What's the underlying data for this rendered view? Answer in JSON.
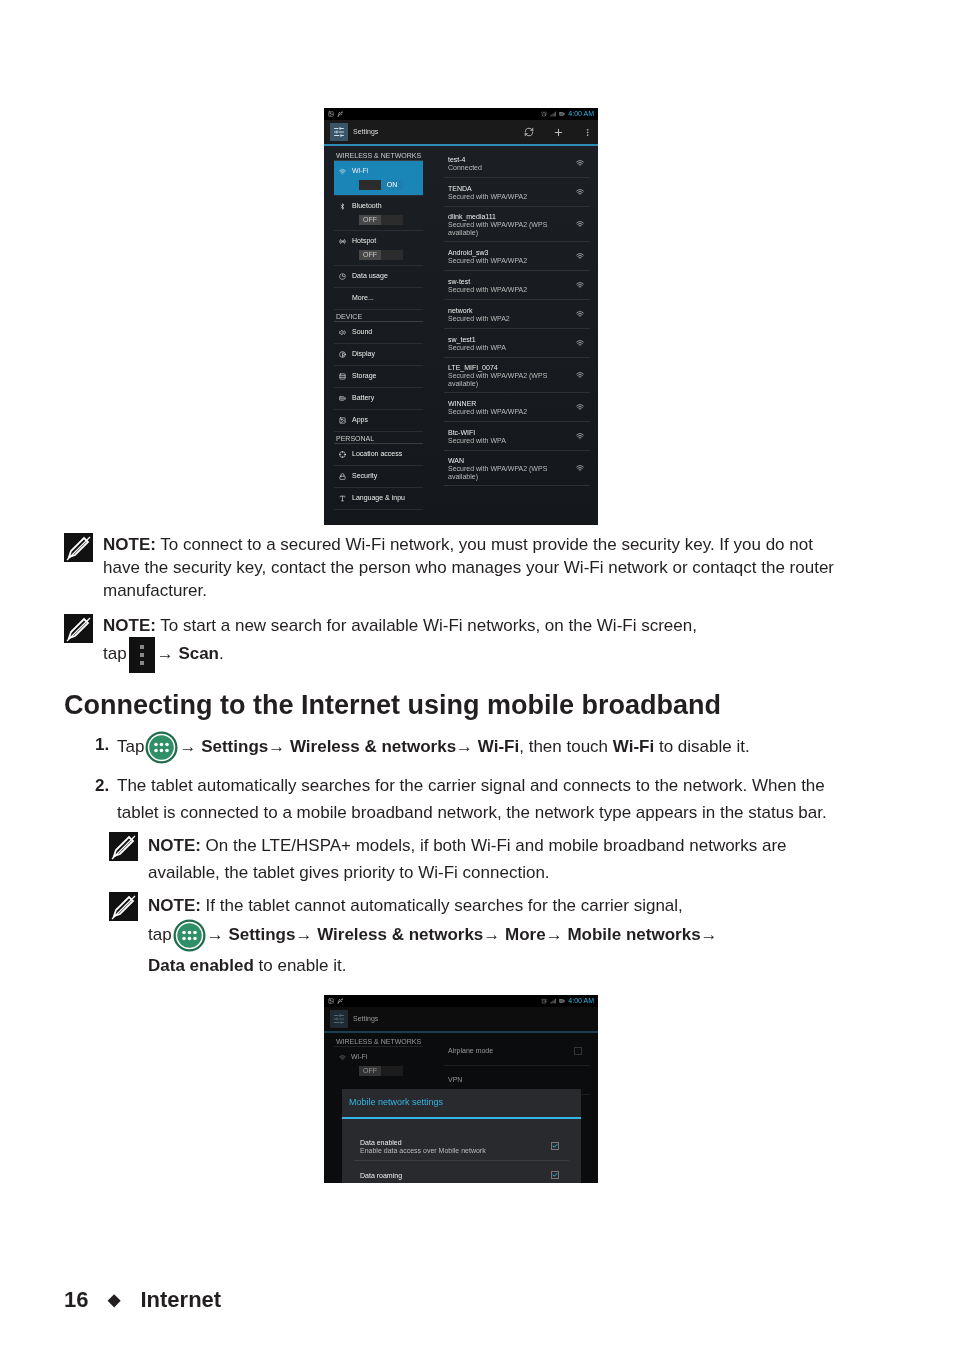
{
  "wifi_screenshot": {
    "status_time": "4:00 AM",
    "title": "Settings",
    "sidebar": [
      {
        "kind": "header",
        "label": "WIRELESS & NETWORKS"
      },
      {
        "kind": "item",
        "label": "Wi-Fi",
        "selected": true,
        "toggle": {
          "label": "ON",
          "on": true
        }
      },
      {
        "kind": "item",
        "label": "Bluetooth",
        "selected": false,
        "toggle": {
          "label": "OFF",
          "on": false
        }
      },
      {
        "kind": "item",
        "label": "Hotspot",
        "selected": false,
        "toggle": {
          "label": "OFF",
          "on": false
        }
      },
      {
        "kind": "item",
        "label": "Data usage",
        "selected": false
      },
      {
        "kind": "item",
        "label": "More...",
        "selected": false
      },
      {
        "kind": "header",
        "label": "DEVICE"
      },
      {
        "kind": "item",
        "label": "Sound",
        "selected": false
      },
      {
        "kind": "item",
        "label": "Display",
        "selected": false
      },
      {
        "kind": "item",
        "label": "Storage",
        "selected": false
      },
      {
        "kind": "item",
        "label": "Battery",
        "selected": false
      },
      {
        "kind": "item",
        "label": "Apps",
        "selected": false
      },
      {
        "kind": "header",
        "label": "PERSONAL"
      },
      {
        "kind": "item",
        "label": "Location access",
        "selected": false
      },
      {
        "kind": "item",
        "label": "Security",
        "selected": false
      },
      {
        "kind": "item",
        "label": "Language & inpu",
        "selected": false
      }
    ],
    "networks": [
      {
        "name": "test-4",
        "status": "Connected"
      },
      {
        "name": "TENDA",
        "status": "Secured with WPA/WPA2"
      },
      {
        "name": "dlink_media111",
        "status": "Secured with WPA/WPA2 (WPS available)"
      },
      {
        "name": "Android_sw3",
        "status": "Secured with WPA/WPA2"
      },
      {
        "name": "sw-test",
        "status": "Secured with WPA/WPA2"
      },
      {
        "name": "network",
        "status": "Secured with WPA2"
      },
      {
        "name": "sw_test1",
        "status": "Secured with WPA"
      },
      {
        "name": "LTE_MIFI_0074",
        "status": "Secured with WPA/WPA2 (WPS available)"
      },
      {
        "name": "WINNER",
        "status": "Secured with WPA/WPA2"
      },
      {
        "name": "Btc-WIFI",
        "status": "Secured with WPA"
      },
      {
        "name": "WAN",
        "status": "Secured with WPA/WPA2 (WPS available)"
      }
    ]
  },
  "notes": [
    {
      "segments": [
        {
          "kind": "text",
          "text": "**NOTE:** To connect to a secured Wi-Fi network, you must provide the security key. If you do not have the security key, contact the person who manages your Wi-Fi network or contaqct the router manufacturer."
        }
      ]
    },
    {
      "segments": [
        {
          "kind": "text",
          "text": "**NOTE:** To start a new search for available Wi-Fi networks, on the Wi-Fi screen,"
        },
        {
          "kind": "break"
        },
        {
          "kind": "text",
          "text": "tap"
        },
        {
          "kind": "menu_icon"
        },
        {
          "kind": "text",
          "text": "→ **Scan**."
        }
      ]
    }
  ],
  "heading": "Connecting to the Internet using mobile broadband",
  "steps": [
    {
      "number": "1.",
      "segments": [
        {
          "kind": "text",
          "text": "Tap"
        },
        {
          "kind": "apps_icon"
        },
        {
          "kind": "text",
          "text": "→ **Settings**→ **Wireless & networks**→ **Wi-Fi**, then touch **Wi-Fi** to disable it."
        }
      ]
    },
    {
      "number": "2.",
      "segments": [
        {
          "kind": "text",
          "text": "The tablet automatically searches for the carrier signal and connects to the network. When the tablet is connected to a mobile broadband network, the network type appears in the status bar."
        }
      ],
      "notes": [
        {
          "segments": [
            {
              "kind": "text",
              "text": "**NOTE:** On the LTE/HSPA+ models, if both Wi-Fi and mobile broadband networks are available, the tablet gives priority to Wi-Fi connection."
            }
          ]
        },
        {
          "segments": [
            {
              "kind": "text",
              "text": "**NOTE:** If the tablet cannot automatically searches for the carrier signal,"
            },
            {
              "kind": "break"
            },
            {
              "kind": "text",
              "text": "tap"
            },
            {
              "kind": "apps_icon"
            },
            {
              "kind": "text",
              "text": "→ **Settings**→ **Wireless & networks**→ **More**→ **Mobile networks**→"
            },
            {
              "kind": "break"
            },
            {
              "kind": "text",
              "text": "**Data enabled** to enable it."
            }
          ]
        }
      ]
    }
  ],
  "mobile_screenshot": {
    "status_time": "4:00 AM",
    "title": "Settings",
    "section_header": "WIRELESS & NETWORKS",
    "wifi_label": "Wi-Fi",
    "wifi_toggle": {
      "label": "OFF",
      "on": false
    },
    "right_items": [
      {
        "label": "Airplane mode",
        "kind": "checkbox",
        "checked": false
      },
      {
        "label": "VPN",
        "kind": "plain"
      }
    ],
    "dialog": {
      "title": "Mobile network settings",
      "items": [
        {
          "label": "Data enabled",
          "description": "Enable data access over Mobile network",
          "checked": true
        },
        {
          "label": "Data roaming",
          "checked": true
        }
      ]
    }
  },
  "footer": {
    "page": "16",
    "separator": "◆",
    "section": "Internet"
  }
}
